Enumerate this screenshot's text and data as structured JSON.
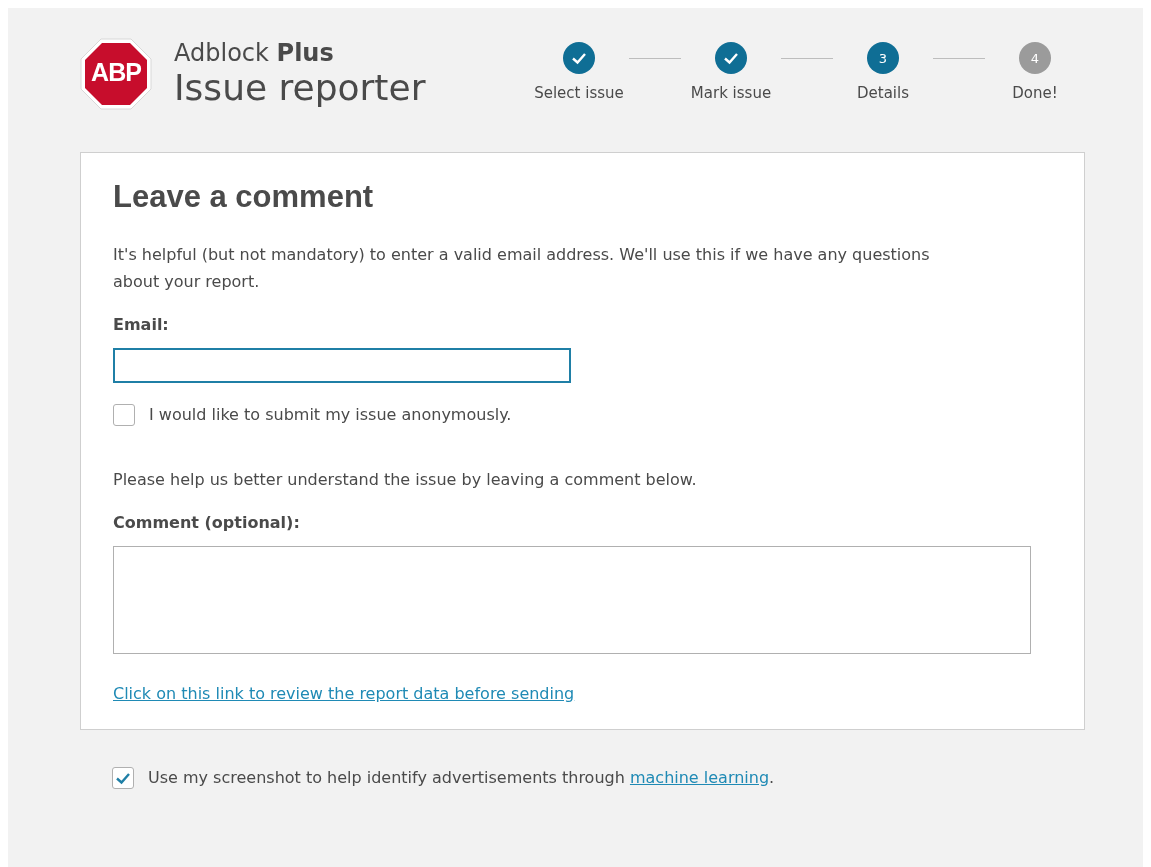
{
  "header": {
    "logo_text": "ABP",
    "brand": "Adblock **Plus**",
    "title": "Issue reporter"
  },
  "steps": [
    {
      "label": "Select issue",
      "completed": true
    },
    {
      "label": "Mark issue",
      "completed": true
    },
    {
      "label": "Details",
      "number": "3",
      "completed": false,
      "current": true
    },
    {
      "label": "Done!",
      "number": "4",
      "completed": false,
      "current": false
    }
  ],
  "form": {
    "heading": "Leave a comment",
    "intro": "It's helpful (but not mandatory) to enter a valid email address. We'll use this if we have any questions about your report.",
    "email_label": "Email:",
    "anonymous": {
      "label": "I would like to submit my issue anonymously.",
      "checked": false
    },
    "comment_intro": "Please help us better understand the issue by leaving a comment below.",
    "comment_label": "Comment (optional):",
    "review_link": "Click on this link to review the report data before sending"
  },
  "footer": {
    "checked": true,
    "text_before": "Use my screenshot to help identify advertisements through ",
    "link": "machine learning",
    "text_after": "."
  }
}
